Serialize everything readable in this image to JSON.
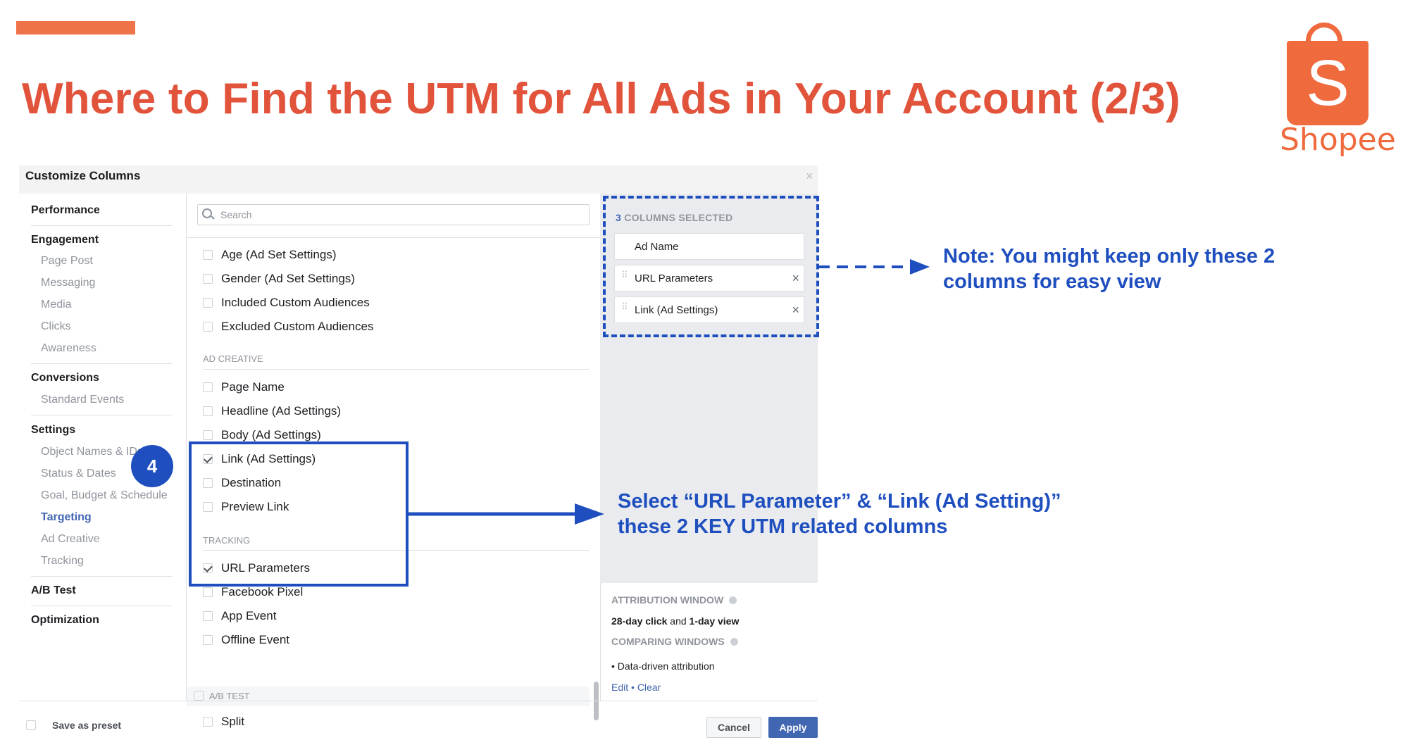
{
  "slide": {
    "title": "Where to Find the UTM for All Ads in Your Account (2/3)",
    "brand_name": "Shopee",
    "logo_glyph": "S",
    "colors": {
      "title": "#e1533b",
      "accent": "#ef7348",
      "annotation": "#1f4fbf"
    }
  },
  "dialog": {
    "title": "Customize Columns",
    "close_icon": "×",
    "search_placeholder": "Search",
    "nav": {
      "performance": "Performance",
      "engagement": "Engagement",
      "engagement_items": [
        "Page Post",
        "Messaging",
        "Media",
        "Clicks",
        "Awareness"
      ],
      "conversions": "Conversions",
      "conversions_items": [
        "Standard Events"
      ],
      "settings": "Settings",
      "settings_items": [
        "Object Names & IDs",
        "Status & Dates",
        "Goal, Budget & Schedule",
        "Targeting",
        "Ad Creative",
        "Tracking"
      ],
      "ab_test": "A/B Test",
      "optimization": "Optimization",
      "active_item": "Targeting"
    },
    "options": {
      "targeting": [
        {
          "label": "Age (Ad Set Settings)",
          "checked": false
        },
        {
          "label": "Gender (Ad Set Settings)",
          "checked": false
        },
        {
          "label": "Included Custom Audiences",
          "checked": false
        },
        {
          "label": "Excluded Custom Audiences",
          "checked": false
        }
      ],
      "ad_creative_header": "AD CREATIVE",
      "ad_creative": [
        {
          "label": "Page Name",
          "checked": false
        },
        {
          "label": "Headline (Ad Settings)",
          "checked": false
        },
        {
          "label": "Body (Ad Settings)",
          "checked": false
        },
        {
          "label": "Link (Ad Settings)",
          "checked": true
        },
        {
          "label": "Destination",
          "checked": false
        },
        {
          "label": "Preview Link",
          "checked": false
        }
      ],
      "tracking_header": "TRACKING",
      "tracking": [
        {
          "label": "URL Parameters",
          "checked": true
        },
        {
          "label": "Facebook Pixel",
          "checked": false
        },
        {
          "label": "App Event",
          "checked": false
        },
        {
          "label": "Offline Event",
          "checked": false
        }
      ],
      "ab_test_header": "A/B TEST",
      "ab_test": [
        {
          "label": "Split",
          "checked": false
        }
      ]
    },
    "selected": {
      "count": "3",
      "label": "COLUMNS SELECTED",
      "items": [
        "Ad Name",
        "URL Parameters",
        "Link (Ad Settings)"
      ],
      "remove_icon": "×"
    },
    "attribution": {
      "window_header": "ATTRIBUTION WINDOW",
      "window_prefix": "28-day click",
      "window_and": "and",
      "window_suffix": "1-day view",
      "comparing_header": "COMPARING WINDOWS",
      "bullet": "Data-driven attribution",
      "edit": "Edit",
      "dot": "•",
      "clear": "Clear"
    },
    "footer": {
      "preset_label": "Save as preset",
      "cancel": "Cancel",
      "apply": "Apply"
    }
  },
  "annotations": {
    "step_number": "4",
    "note_top_line1": "Note: You might keep only these 2",
    "note_top_line2": "columns for easy view",
    "note_mid_line1": "Select “URL Parameter” & “Link (Ad Setting)”",
    "note_mid_line2": "these 2 KEY UTM related columns"
  }
}
